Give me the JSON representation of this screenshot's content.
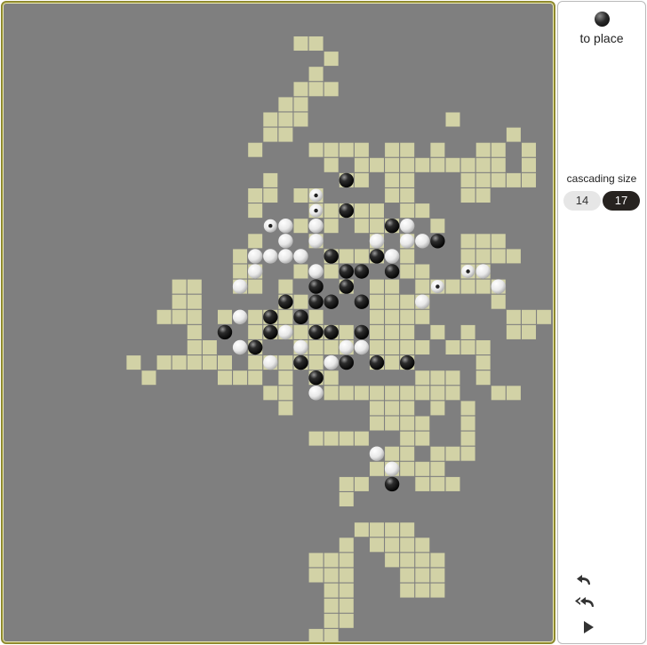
{
  "panel": {
    "to_place_label": "to place",
    "to_place_stone": "black",
    "cascading_size_label": "cascading size",
    "sizes": [
      {
        "label": "14",
        "selected": false
      },
      {
        "label": "17",
        "selected": true
      }
    ],
    "controls": [
      "undo-icon",
      "undo-all-icon",
      "play-icon"
    ]
  },
  "colors": {
    "board_bg": "#7f7f7f",
    "cell": "#d2d2a6",
    "frame": "#8f8a2e",
    "selected_button": "#272320"
  },
  "board": {
    "cells": [
      [
        15,
        0
      ],
      [
        16,
        0
      ],
      [
        17,
        1
      ],
      [
        16,
        2
      ],
      [
        15,
        3
      ],
      [
        16,
        3
      ],
      [
        17,
        3
      ],
      [
        14,
        4
      ],
      [
        15,
        4
      ],
      [
        13,
        5
      ],
      [
        14,
        5
      ],
      [
        15,
        5
      ],
      [
        13,
        6
      ],
      [
        14,
        6
      ],
      [
        25,
        5
      ],
      [
        12,
        7
      ],
      [
        16,
        7
      ],
      [
        17,
        7
      ],
      [
        18,
        7
      ],
      [
        19,
        7
      ],
      [
        21,
        7
      ],
      [
        22,
        7
      ],
      [
        24,
        7
      ],
      [
        27,
        7
      ],
      [
        28,
        7
      ],
      [
        29,
        6
      ],
      [
        30,
        7
      ],
      [
        17,
        8
      ],
      [
        19,
        8
      ],
      [
        20,
        8
      ],
      [
        21,
        8
      ],
      [
        22,
        8
      ],
      [
        23,
        8
      ],
      [
        24,
        8
      ],
      [
        25,
        8
      ],
      [
        26,
        8
      ],
      [
        27,
        8
      ],
      [
        28,
        8
      ],
      [
        30,
        8
      ],
      [
        13,
        9
      ],
      [
        18,
        9
      ],
      [
        19,
        9
      ],
      [
        21,
        9
      ],
      [
        22,
        9
      ],
      [
        26,
        9
      ],
      [
        27,
        9
      ],
      [
        28,
        9
      ],
      [
        29,
        9
      ],
      [
        30,
        9
      ],
      [
        13,
        10
      ],
      [
        12,
        10
      ],
      [
        15,
        10
      ],
      [
        16,
        10
      ],
      [
        21,
        10
      ],
      [
        22,
        10
      ],
      [
        26,
        10
      ],
      [
        27,
        10
      ],
      [
        12,
        11
      ],
      [
        16,
        11
      ],
      [
        17,
        11
      ],
      [
        18,
        11
      ],
      [
        19,
        11
      ],
      [
        20,
        11
      ],
      [
        22,
        11
      ],
      [
        23,
        11
      ],
      [
        15,
        12
      ],
      [
        17,
        12
      ],
      [
        19,
        12
      ],
      [
        20,
        12
      ],
      [
        21,
        12
      ],
      [
        24,
        12
      ],
      [
        12,
        13
      ],
      [
        16,
        13
      ],
      [
        20,
        13
      ],
      [
        22,
        13
      ],
      [
        26,
        13
      ],
      [
        27,
        13
      ],
      [
        28,
        13
      ],
      [
        11,
        14
      ],
      [
        17,
        14
      ],
      [
        18,
        14
      ],
      [
        19,
        14
      ],
      [
        20,
        14
      ],
      [
        22,
        14
      ],
      [
        26,
        14
      ],
      [
        27,
        14
      ],
      [
        28,
        14
      ],
      [
        29,
        14
      ],
      [
        11,
        15
      ],
      [
        12,
        15
      ],
      [
        15,
        15
      ],
      [
        17,
        15
      ],
      [
        22,
        15
      ],
      [
        23,
        15
      ],
      [
        26,
        15
      ],
      [
        27,
        15
      ],
      [
        7,
        16
      ],
      [
        8,
        16
      ],
      [
        11,
        16
      ],
      [
        12,
        16
      ],
      [
        14,
        16
      ],
      [
        18,
        16
      ],
      [
        20,
        16
      ],
      [
        21,
        16
      ],
      [
        23,
        16
      ],
      [
        24,
        16
      ],
      [
        25,
        16
      ],
      [
        26,
        16
      ],
      [
        27,
        16
      ],
      [
        28,
        16
      ],
      [
        7,
        17
      ],
      [
        8,
        17
      ],
      [
        14,
        17
      ],
      [
        15,
        17
      ],
      [
        20,
        17
      ],
      [
        21,
        17
      ],
      [
        22,
        17
      ],
      [
        23,
        17
      ],
      [
        28,
        17
      ],
      [
        6,
        18
      ],
      [
        7,
        18
      ],
      [
        8,
        18
      ],
      [
        10,
        18
      ],
      [
        12,
        18
      ],
      [
        13,
        18
      ],
      [
        14,
        18
      ],
      [
        16,
        18
      ],
      [
        20,
        18
      ],
      [
        21,
        18
      ],
      [
        22,
        18
      ],
      [
        23,
        18
      ],
      [
        29,
        18
      ],
      [
        30,
        18
      ],
      [
        31,
        18
      ],
      [
        8,
        19
      ],
      [
        12,
        19
      ],
      [
        13,
        19
      ],
      [
        14,
        19
      ],
      [
        15,
        19
      ],
      [
        16,
        19
      ],
      [
        17,
        19
      ],
      [
        18,
        19
      ],
      [
        20,
        19
      ],
      [
        21,
        19
      ],
      [
        22,
        19
      ],
      [
        24,
        19
      ],
      [
        26,
        19
      ],
      [
        29,
        19
      ],
      [
        30,
        19
      ],
      [
        8,
        20
      ],
      [
        9,
        20
      ],
      [
        12,
        20
      ],
      [
        15,
        20
      ],
      [
        16,
        20
      ],
      [
        17,
        20
      ],
      [
        18,
        20
      ],
      [
        20,
        20
      ],
      [
        21,
        20
      ],
      [
        22,
        20
      ],
      [
        23,
        20
      ],
      [
        25,
        20
      ],
      [
        26,
        20
      ],
      [
        27,
        20
      ],
      [
        4,
        21
      ],
      [
        6,
        21
      ],
      [
        7,
        21
      ],
      [
        8,
        21
      ],
      [
        9,
        21
      ],
      [
        10,
        21
      ],
      [
        12,
        21
      ],
      [
        13,
        21
      ],
      [
        14,
        21
      ],
      [
        15,
        21
      ],
      [
        16,
        21
      ],
      [
        20,
        21
      ],
      [
        21,
        21
      ],
      [
        22,
        21
      ],
      [
        27,
        21
      ],
      [
        5,
        22
      ],
      [
        10,
        22
      ],
      [
        11,
        22
      ],
      [
        12,
        22
      ],
      [
        14,
        22
      ],
      [
        16,
        22
      ],
      [
        17,
        22
      ],
      [
        23,
        22
      ],
      [
        24,
        22
      ],
      [
        25,
        22
      ],
      [
        27,
        22
      ],
      [
        13,
        23
      ],
      [
        14,
        23
      ],
      [
        17,
        23
      ],
      [
        18,
        23
      ],
      [
        19,
        23
      ],
      [
        20,
        23
      ],
      [
        21,
        23
      ],
      [
        22,
        23
      ],
      [
        23,
        23
      ],
      [
        24,
        23
      ],
      [
        25,
        23
      ],
      [
        28,
        23
      ],
      [
        29,
        23
      ],
      [
        14,
        24
      ],
      [
        20,
        24
      ],
      [
        21,
        24
      ],
      [
        22,
        24
      ],
      [
        24,
        24
      ],
      [
        26,
        24
      ],
      [
        20,
        25
      ],
      [
        21,
        25
      ],
      [
        22,
        25
      ],
      [
        23,
        25
      ],
      [
        26,
        25
      ],
      [
        16,
        26
      ],
      [
        17,
        26
      ],
      [
        18,
        26
      ],
      [
        19,
        26
      ],
      [
        22,
        26
      ],
      [
        23,
        26
      ],
      [
        26,
        26
      ],
      [
        21,
        27
      ],
      [
        22,
        27
      ],
      [
        24,
        27
      ],
      [
        25,
        27
      ],
      [
        26,
        27
      ],
      [
        20,
        28
      ],
      [
        21,
        28
      ],
      [
        22,
        28
      ],
      [
        23,
        28
      ],
      [
        24,
        28
      ],
      [
        18,
        29
      ],
      [
        19,
        29
      ],
      [
        23,
        29
      ],
      [
        24,
        29
      ],
      [
        25,
        29
      ],
      [
        18,
        30
      ],
      [
        19,
        32
      ],
      [
        20,
        32
      ],
      [
        21,
        32
      ],
      [
        22,
        32
      ],
      [
        18,
        33
      ],
      [
        20,
        33
      ],
      [
        21,
        33
      ],
      [
        22,
        33
      ],
      [
        23,
        33
      ],
      [
        16,
        34
      ],
      [
        17,
        34
      ],
      [
        18,
        34
      ],
      [
        21,
        34
      ],
      [
        22,
        34
      ],
      [
        23,
        34
      ],
      [
        24,
        34
      ],
      [
        16,
        35
      ],
      [
        17,
        35
      ],
      [
        18,
        35
      ],
      [
        22,
        35
      ],
      [
        23,
        35
      ],
      [
        24,
        35
      ],
      [
        17,
        36
      ],
      [
        18,
        36
      ],
      [
        22,
        36
      ],
      [
        23,
        36
      ],
      [
        24,
        36
      ],
      [
        17,
        37
      ],
      [
        18,
        37
      ],
      [
        17,
        38
      ],
      [
        18,
        38
      ],
      [
        16,
        39
      ],
      [
        17,
        39
      ],
      [
        17,
        40
      ],
      [
        18,
        41
      ]
    ],
    "stones": [
      {
        "c": 18,
        "r": 9,
        "color": "black"
      },
      {
        "c": 16,
        "r": 10,
        "color": "marker"
      },
      {
        "c": 16,
        "r": 11,
        "color": "marker"
      },
      {
        "c": 18,
        "r": 11,
        "color": "black"
      },
      {
        "c": 13,
        "r": 12,
        "color": "marker"
      },
      {
        "c": 14,
        "r": 12,
        "color": "white"
      },
      {
        "c": 16,
        "r": 12,
        "color": "white"
      },
      {
        "c": 21,
        "r": 12,
        "color": "black"
      },
      {
        "c": 22,
        "r": 12,
        "color": "white"
      },
      {
        "c": 14,
        "r": 13,
        "color": "white"
      },
      {
        "c": 16,
        "r": 13,
        "color": "white"
      },
      {
        "c": 20,
        "r": 13,
        "color": "white"
      },
      {
        "c": 22,
        "r": 13,
        "color": "white"
      },
      {
        "c": 23,
        "r": 13,
        "color": "white"
      },
      {
        "c": 24,
        "r": 13,
        "color": "black"
      },
      {
        "c": 12,
        "r": 14,
        "color": "white"
      },
      {
        "c": 13,
        "r": 14,
        "color": "white"
      },
      {
        "c": 14,
        "r": 14,
        "color": "white"
      },
      {
        "c": 15,
        "r": 14,
        "color": "white"
      },
      {
        "c": 17,
        "r": 14,
        "color": "black"
      },
      {
        "c": 20,
        "r": 14,
        "color": "black"
      },
      {
        "c": 21,
        "r": 14,
        "color": "white"
      },
      {
        "c": 12,
        "r": 15,
        "color": "white"
      },
      {
        "c": 16,
        "r": 15,
        "color": "white"
      },
      {
        "c": 18,
        "r": 15,
        "color": "black"
      },
      {
        "c": 19,
        "r": 15,
        "color": "black"
      },
      {
        "c": 21,
        "r": 15,
        "color": "black"
      },
      {
        "c": 26,
        "r": 15,
        "color": "marker"
      },
      {
        "c": 27,
        "r": 15,
        "color": "white"
      },
      {
        "c": 11,
        "r": 16,
        "color": "white"
      },
      {
        "c": 16,
        "r": 16,
        "color": "black"
      },
      {
        "c": 18,
        "r": 16,
        "color": "black"
      },
      {
        "c": 24,
        "r": 16,
        "color": "marker"
      },
      {
        "c": 28,
        "r": 16,
        "color": "white"
      },
      {
        "c": 14,
        "r": 17,
        "color": "black"
      },
      {
        "c": 16,
        "r": 17,
        "color": "black"
      },
      {
        "c": 17,
        "r": 17,
        "color": "black"
      },
      {
        "c": 19,
        "r": 17,
        "color": "black"
      },
      {
        "c": 23,
        "r": 17,
        "color": "white"
      },
      {
        "c": 11,
        "r": 18,
        "color": "white"
      },
      {
        "c": 13,
        "r": 18,
        "color": "black"
      },
      {
        "c": 15,
        "r": 18,
        "color": "black"
      },
      {
        "c": 10,
        "r": 19,
        "color": "black"
      },
      {
        "c": 13,
        "r": 19,
        "color": "black"
      },
      {
        "c": 14,
        "r": 19,
        "color": "white"
      },
      {
        "c": 16,
        "r": 19,
        "color": "black"
      },
      {
        "c": 17,
        "r": 19,
        "color": "black"
      },
      {
        "c": 19,
        "r": 19,
        "color": "black"
      },
      {
        "c": 11,
        "r": 20,
        "color": "white"
      },
      {
        "c": 12,
        "r": 20,
        "color": "black"
      },
      {
        "c": 15,
        "r": 20,
        "color": "white"
      },
      {
        "c": 18,
        "r": 20,
        "color": "white"
      },
      {
        "c": 19,
        "r": 20,
        "color": "white"
      },
      {
        "c": 13,
        "r": 21,
        "color": "white"
      },
      {
        "c": 15,
        "r": 21,
        "color": "black"
      },
      {
        "c": 17,
        "r": 21,
        "color": "white"
      },
      {
        "c": 18,
        "r": 21,
        "color": "black"
      },
      {
        "c": 20,
        "r": 21,
        "color": "black"
      },
      {
        "c": 22,
        "r": 21,
        "color": "black"
      },
      {
        "c": 16,
        "r": 22,
        "color": "black"
      },
      {
        "c": 16,
        "r": 23,
        "color": "white"
      },
      {
        "c": 20,
        "r": 27,
        "color": "white"
      },
      {
        "c": 21,
        "r": 28,
        "color": "white"
      },
      {
        "c": 21,
        "r": 29,
        "color": "black"
      }
    ]
  }
}
